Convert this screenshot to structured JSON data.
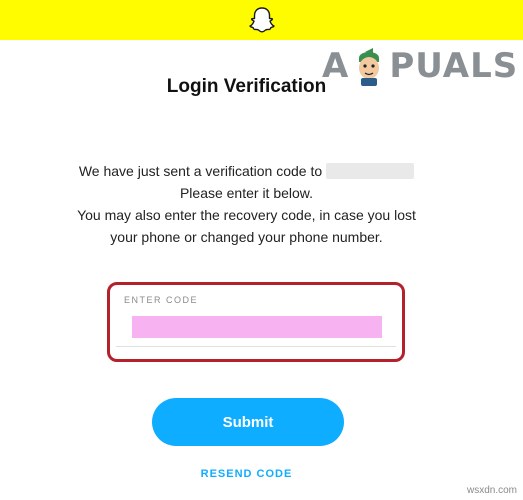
{
  "header": {
    "logo_icon": "snapchat-ghost-icon",
    "background_color": "#fffc00"
  },
  "watermark": {
    "text_left": "A",
    "text_right": "PUALS"
  },
  "page": {
    "title": "Login Verification",
    "message_line1": "We have just sent a verification code to",
    "message_line2": "Please enter it below.",
    "message_line3": "You may also enter the recovery code, in case you lost",
    "message_line4": "your phone or changed your phone number."
  },
  "code_field": {
    "label": "ENTER CODE",
    "value": "",
    "highlight_color": "#f7b2f1",
    "outline_color": "#b3212b"
  },
  "actions": {
    "submit_label": "Submit",
    "resend_label": "RESEND CODE",
    "accent_color": "#0fadff"
  },
  "footer": {
    "site": "wsxdn.com"
  }
}
